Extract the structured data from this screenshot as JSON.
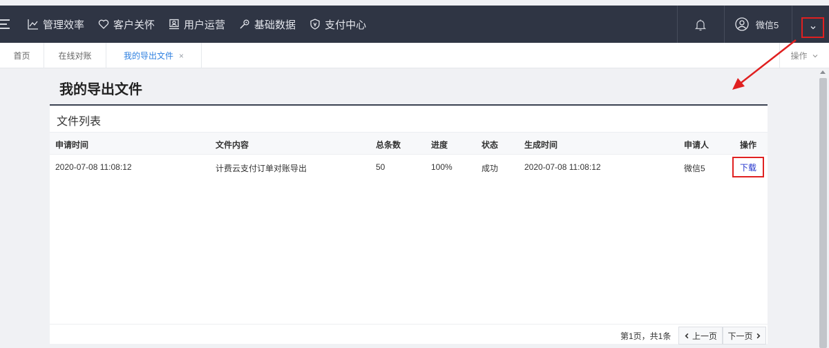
{
  "nav": {
    "items": [
      {
        "label": "管理效率",
        "icon": "chart-line-icon"
      },
      {
        "label": "客户关怀",
        "icon": "heart-icon"
      },
      {
        "label": "用户运营",
        "icon": "user-badge-icon"
      },
      {
        "label": "基础数据",
        "icon": "wrench-icon"
      },
      {
        "label": "支付中心",
        "icon": "shield-icon"
      }
    ],
    "user_name": "微信5"
  },
  "tabs": {
    "items": [
      {
        "label": "首页"
      },
      {
        "label": "在线对账"
      },
      {
        "label": "我的导出文件",
        "close": "×"
      }
    ],
    "ops_label": "操作"
  },
  "page": {
    "title": "我的导出文件",
    "card_title": "文件列表"
  },
  "table": {
    "headers": [
      "申请时间",
      "文件内容",
      "总条数",
      "进度",
      "状态",
      "生成时间",
      "申请人",
      "操作"
    ],
    "rows": [
      [
        "2020-07-08 11:08:12",
        "计费云支付订单对账导出",
        "50",
        "100%",
        "成功",
        "2020-07-08 11:08:12",
        "微信5",
        "下载"
      ]
    ]
  },
  "pagination": {
    "info": "第1页，共1条",
    "prev": "上一页",
    "next": "下一页"
  },
  "colors": {
    "topbar": "#2f3544",
    "accent_tab": "#2d7fe0",
    "highlight": "#e02020",
    "link": "#2233cc"
  }
}
